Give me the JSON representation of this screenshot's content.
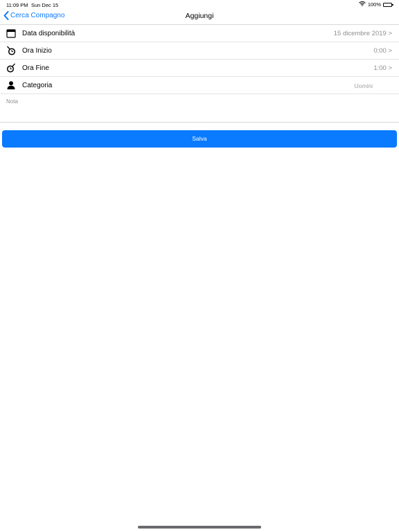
{
  "status_bar": {
    "time": "11:09 PM",
    "date": "Sun Dec 15",
    "battery": "100%"
  },
  "nav": {
    "back_label": "Cerca Compagno",
    "title": "Aggiungi"
  },
  "rows": [
    {
      "label": "Data disponibilità",
      "value": "15 dicembre 2019 >",
      "icon": "calendar-icon"
    },
    {
      "label": "Ora Inizio",
      "value": "0:00 >",
      "icon": "stopwatch-start-icon"
    },
    {
      "label": "Ora Fine",
      "value": "1:00 >",
      "icon": "stopwatch-end-icon"
    },
    {
      "label": "Categoria",
      "value": "Uomini",
      "icon": "person-icon"
    }
  ],
  "note": {
    "label": "Nota"
  },
  "save_label": "Salva",
  "colors": {
    "accent": "#0a7aff",
    "secondary_text": "#8e8e93"
  }
}
